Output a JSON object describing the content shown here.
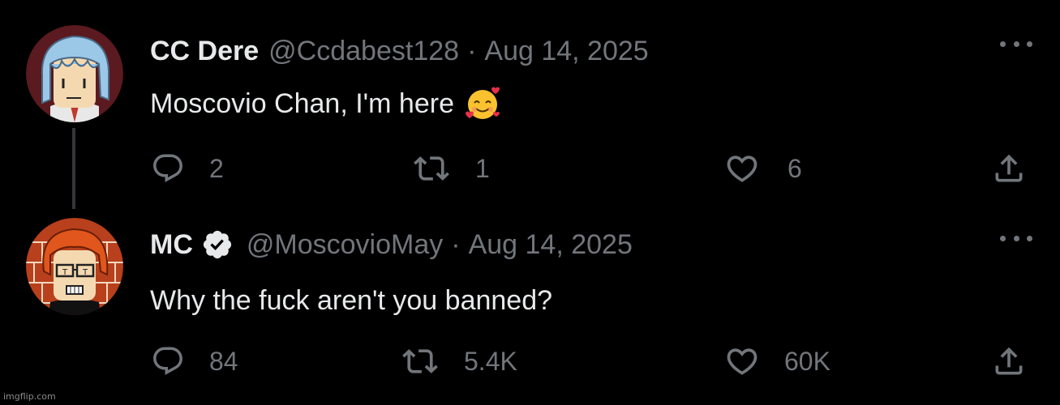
{
  "tweets": [
    {
      "display_name": "CC Dere",
      "handle": "@Ccdabest128",
      "separator": "·",
      "date": "Aug 14, 2025",
      "verified": false,
      "text": "Moscovio Chan, I'm here",
      "emoji": "smiling-face-with-hearts",
      "avatar": "anime-avatar-blue-hair",
      "replies": "2",
      "retweets": "1",
      "likes": "6"
    },
    {
      "display_name": "MC",
      "handle": "@MoscovioMay",
      "separator": "·",
      "date": "Aug 14, 2025",
      "verified": true,
      "text": "Why the fuck aren't you banned?",
      "avatar": "anime-avatar-orange-hair-glasses",
      "replies": "84",
      "retweets": "5.4K",
      "likes": "60K"
    }
  ],
  "watermark": "imgflip.com",
  "colors": {
    "background": "#000000",
    "primary_text": "#e7e9ea",
    "secondary_text": "#71767b",
    "thread_line": "#333639",
    "verified_badge": "#e7e9ea"
  }
}
